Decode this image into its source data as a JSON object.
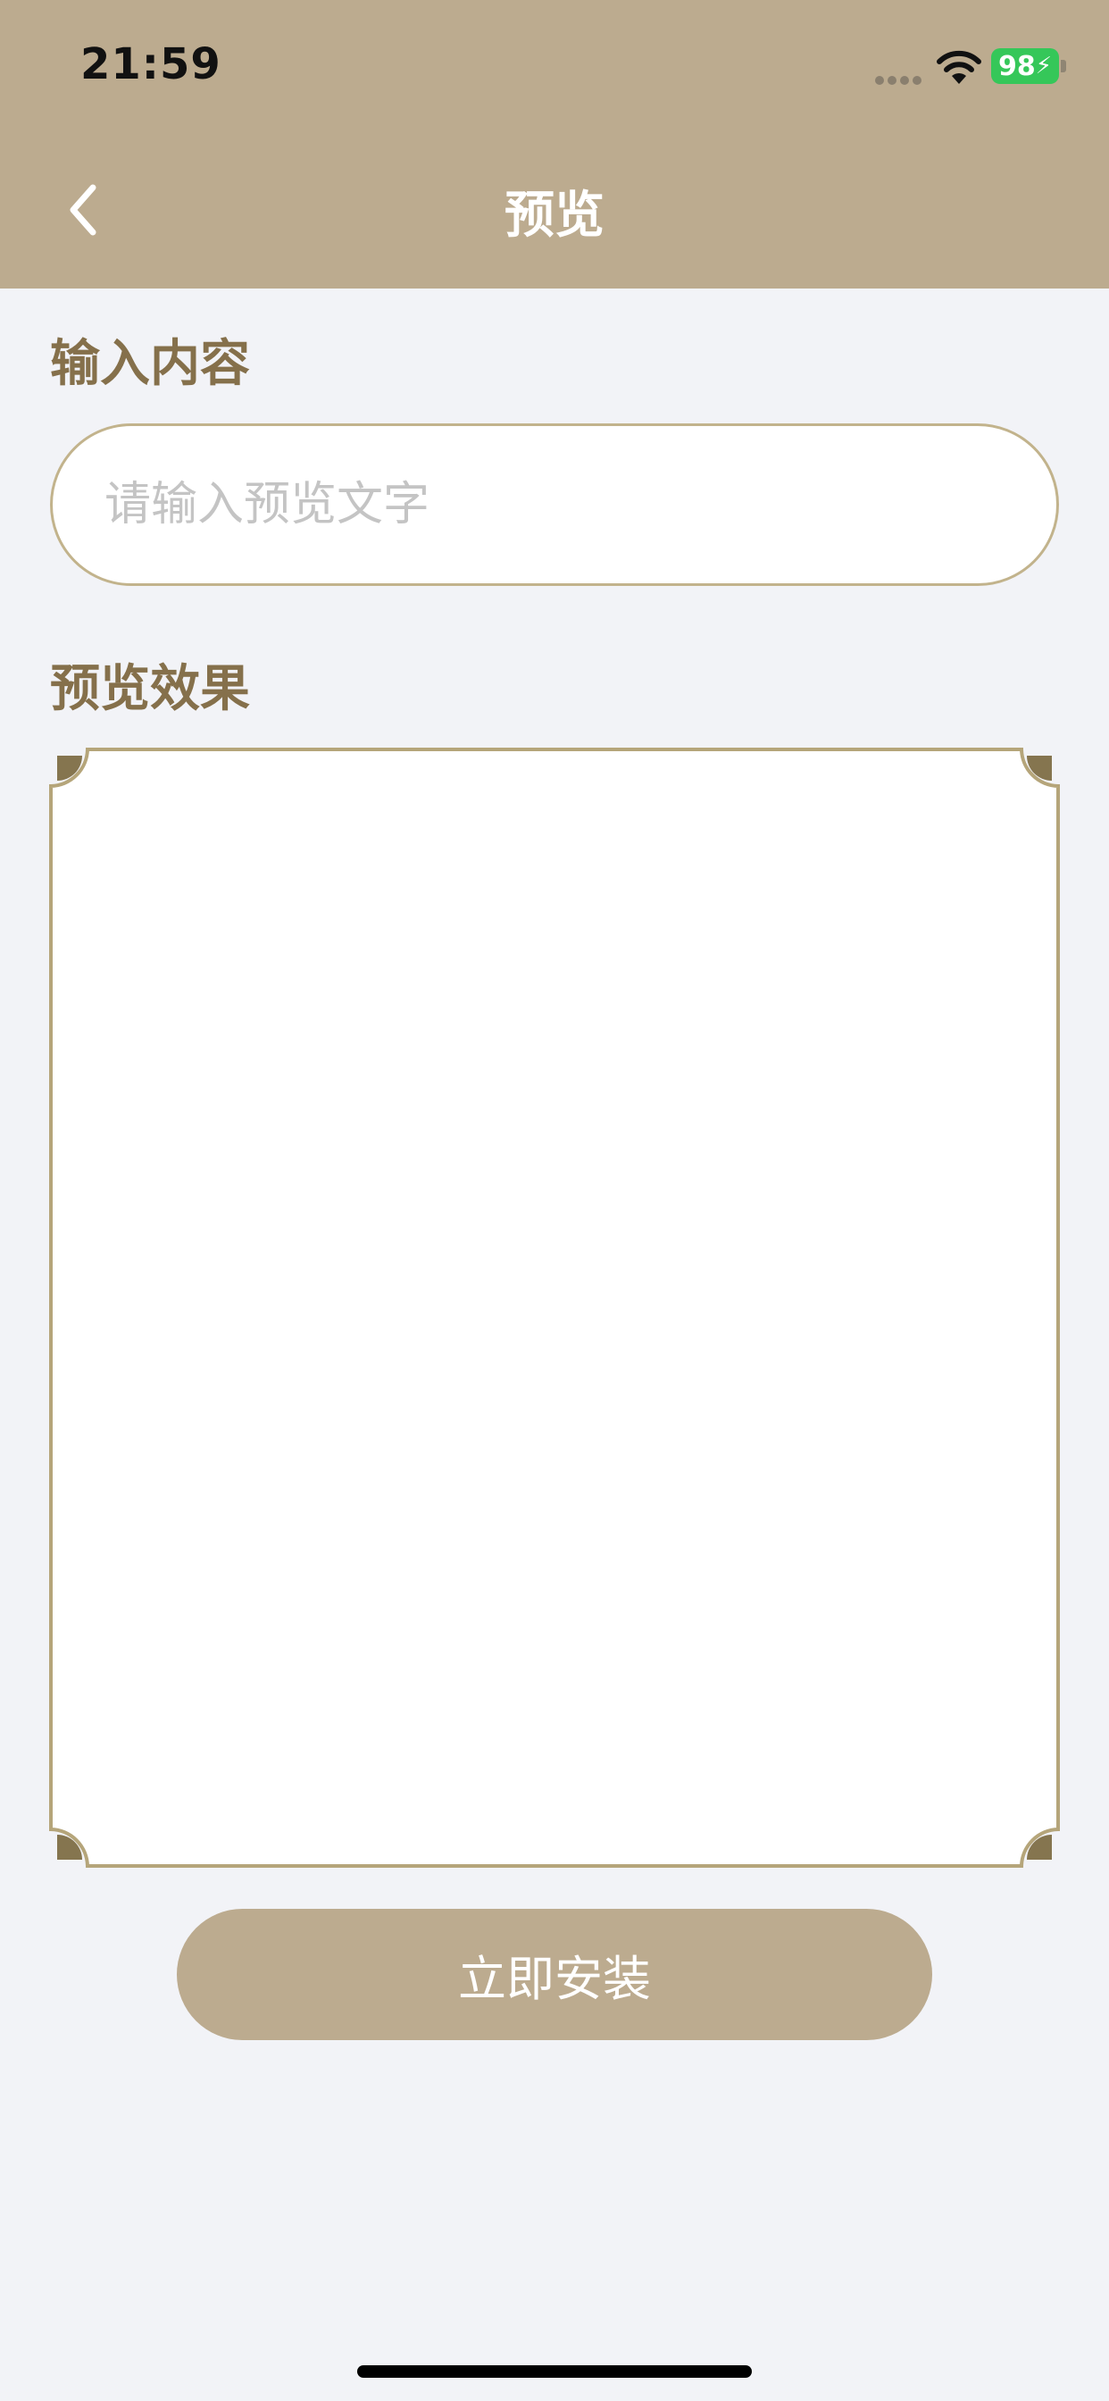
{
  "status_bar": {
    "time": "21:59",
    "battery_level": "98",
    "battery_color": "#35c759",
    "icons": [
      "signal-icon",
      "wifi-icon",
      "battery-icon"
    ]
  },
  "nav": {
    "title": "预览",
    "back_icon": "chevron-left-icon"
  },
  "input_section": {
    "label": "输入内容",
    "placeholder": "请输入预览文字",
    "value": ""
  },
  "preview_section": {
    "label": "预览效果",
    "text": ""
  },
  "actions": {
    "install_label": "立即安装"
  },
  "colors": {
    "header_bg": "#bcab8f",
    "accent_text": "#85704b",
    "frame_border": "#b5a57a",
    "corner_fill": "#85754f",
    "page_bg": "#f2f3f7"
  }
}
